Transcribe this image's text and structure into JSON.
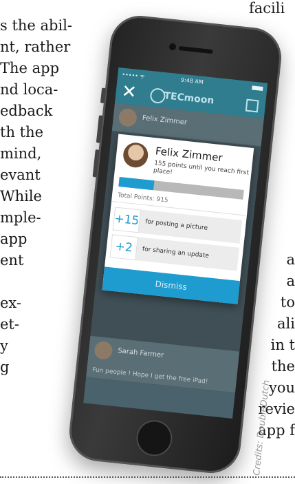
{
  "article": {
    "left_lines": [
      "s the abil-",
      "nt, rather",
      "The app",
      "nd loca-",
      "edback",
      "th  the",
      "mind,",
      "evant",
      "While",
      "mple-",
      "app",
      "ent",
      "",
      "ex-",
      "et-",
      "y",
      "g"
    ],
    "right_lines": [
      "a",
      "a",
      "to",
      "ali",
      "in t",
      "the",
      "you",
      "revie",
      "app f"
    ],
    "top_right": "facili",
    "credits": "Credits: DoubleDutch"
  },
  "phone": {
    "status": {
      "carrier": "••••• ᯤ",
      "time": "9:48 AM"
    },
    "nav": {
      "close_icon": "close-icon",
      "brand": "TECmoon",
      "edit_icon": "edit-icon"
    },
    "feed": {
      "top_name": "Felix Zimmer",
      "bottom_name": "Sarah Farmer",
      "bottom_text": "Fun people ! Hope I get the free iPad!"
    },
    "popup": {
      "name": "Felix Zimmer",
      "subtitle": "155 points until you reach first place!",
      "progress": 0.28,
      "total_points": "Total Points: 915",
      "items": [
        {
          "value": "+15",
          "label": "for posting a picture"
        },
        {
          "value": "+2",
          "label": "for sharing an update"
        }
      ],
      "dismiss_label": "Dismiss"
    }
  },
  "colors": {
    "accent": "#1f9ccf",
    "navbar": "#2f7d8e"
  }
}
